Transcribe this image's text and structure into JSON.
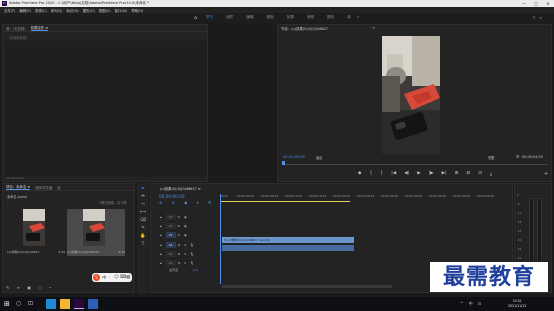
{
  "window": {
    "app_icon": "Pr",
    "title": "Adobe Premiere Pro 2020 - C:\\用户\\ttlop\\文档\\Adobe\\Premiere Pro\\14.0\\未命名 *",
    "minimize": "—",
    "maximize": "□",
    "close": "✕"
  },
  "menubar": [
    "文件(F)",
    "编辑(E)",
    "剪辑(C)",
    "序列(S)",
    "标记(M)",
    "图形(G)",
    "视图(V)",
    "窗口(W)",
    "帮助(H)"
  ],
  "workspace": {
    "home_icon": "home-icon",
    "tabs": [
      "学习",
      "组件",
      "编辑",
      "颜色",
      "效果",
      "音频",
      "图形",
      "库"
    ],
    "active": "学习",
    "more": "»"
  },
  "source_panel": {
    "tabs": [
      "源：(无剪辑)",
      "效果控件 ≡"
    ],
    "active_tab": "效果控件 ≡",
    "path": "（未选择剪辑）",
    "footer": "00;00;00;00"
  },
  "program_panel": {
    "title": "节目：(u)效果(0)(0)(0)46627",
    "menu": "≡",
    "timecode": "00;00;00;00",
    "fit_label": "适合",
    "quality_label": "完整",
    "duration": "00;00;04;29",
    "transport": [
      "◆",
      "{",
      "}",
      "|◀",
      "◀|",
      "▶",
      "|▶",
      "▶|",
      "⊞",
      "⊟",
      "⊡",
      "⤓"
    ],
    "add_button": "+"
  },
  "project_panel": {
    "tabs": [
      "项目：未命名 ≡",
      "媒体浏览器",
      "库"
    ],
    "active_tab": "项目：未命名 ≡",
    "project_name": "未命名.prproj",
    "filter_placeholder": "⌕",
    "selection": "1项已选择，共 2项",
    "items": [
      {
        "label": "(u)效果(0)(0)(0)46627",
        "duration": "4;29"
      },
      {
        "label": "(u)效果(0)(0)(0)46627",
        "duration": "4;29"
      }
    ],
    "footer_icons": "✎ ≡ ▣ ○ ─"
  },
  "tools": [
    "▸",
    "⇹",
    "⇿",
    "⟷",
    "⌫",
    "✎",
    "✋",
    "T"
  ],
  "timeline": {
    "sequence_title": "(u)效果(0)(0)(0)46627 ≡",
    "timecode": "00;00;00;00",
    "tools": "⊕ ⊘ ◆ ▾ ⚙",
    "ruler": [
      "00;00",
      "00;00;04;29",
      "00;00;09;29",
      "00;00;14;29",
      "00;00;19;29",
      "00;00;24;29",
      "00;00;29;29",
      "00;00;34;28",
      "00;00;39;28",
      "00;00;44;28",
      "00;00;49;28",
      "00;00;54;28"
    ],
    "video_tracks": [
      "V3",
      "V2",
      "V1"
    ],
    "audio_tracks": [
      "A1",
      "A2",
      "A3"
    ],
    "clip_label": "fx (u)效果(0)(0)(0)46627.mp4 [V]",
    "mix_label": "主声道",
    "mix_value": "0.0"
  },
  "meter": {
    "db": [
      "0",
      "-6",
      "-12",
      "-18",
      "-24",
      "-30",
      "-36",
      "-42",
      "-48",
      "-54",
      "dB"
    ],
    "solo": "S S"
  },
  "watermark": "最需教育",
  "taskbar": {
    "start": "⊞",
    "search": "○",
    "taskview": "⊡",
    "tray": "^ 中 ⊡",
    "time": "10:51",
    "date": "2021/11/12"
  },
  "colors": {
    "accent": "#4f8fe8",
    "clip_video": "#6c97cc",
    "clip_audio": "#4a6ba0",
    "workbar": "#e8d05a",
    "watermark_text": "#1f3f9c"
  }
}
